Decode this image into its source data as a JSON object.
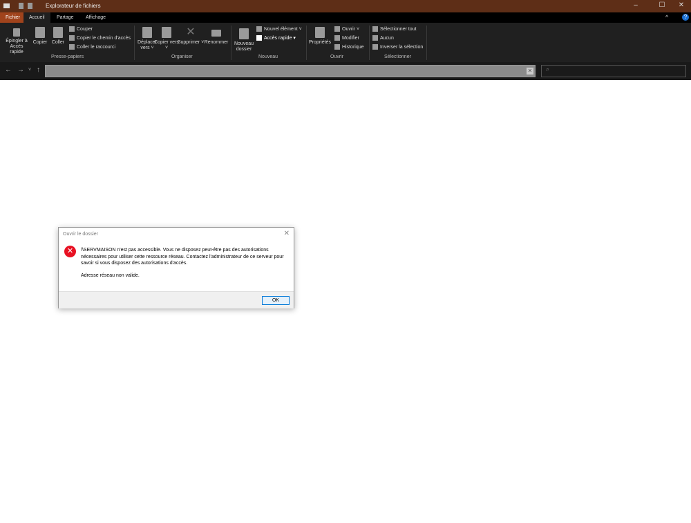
{
  "window": {
    "title": "Explorateur de fichiers",
    "minimize": "–",
    "maximize": "☐",
    "close": "✕"
  },
  "tabs": [
    {
      "label": "Fichier"
    },
    {
      "label": "Accueil"
    },
    {
      "label": "Partage"
    },
    {
      "label": "Affichage"
    }
  ],
  "ribbon": {
    "pin": "Épingler à Accès rapide",
    "copy": "Copier",
    "paste": "Coller",
    "cut": "Couper",
    "copy_path": "Copier le chemin d'accès",
    "paste_shortcut": "Coller le raccourci",
    "group_clipboard": "Presse-papiers",
    "move_to": "Déplacer vers ˅",
    "copy_to": "Copier vers ˅",
    "delete": "Supprimer ˅",
    "rename": "Renommer",
    "group_organize": "Organiser",
    "new_folder": "Nouveau dossier",
    "new_item": "Nouvel élément ˅",
    "quick_access": "Accès rapide ▾",
    "group_new": "Nouveau",
    "properties": "Propriétés",
    "open": "Ouvrir ˅",
    "edit": "Modifier",
    "history": "Historique",
    "group_open": "Ouvrir",
    "select_all": "Sélectionner tout",
    "select_none": "Aucun",
    "invert_selection": "Inverser la sélection",
    "group_select": "Sélectionner",
    "collapse": "^",
    "help": "?"
  },
  "nav": {
    "back": "←",
    "forward": "→",
    "recent": "˅",
    "up": "↑",
    "address": "",
    "search_icon": "⌕"
  },
  "dialog": {
    "title": "Ouvrir le dossier",
    "message": "\\\\SERVMAISON n'est pas accessible. Vous ne disposez peut-être pas des autorisations nécessaires pour utiliser cette ressource réseau. Contactez l'administrateur de ce serveur pour savoir si vous disposez des autorisations d'accès.",
    "detail": "Adresse réseau non valide.",
    "ok": "OK",
    "close": "✕"
  }
}
